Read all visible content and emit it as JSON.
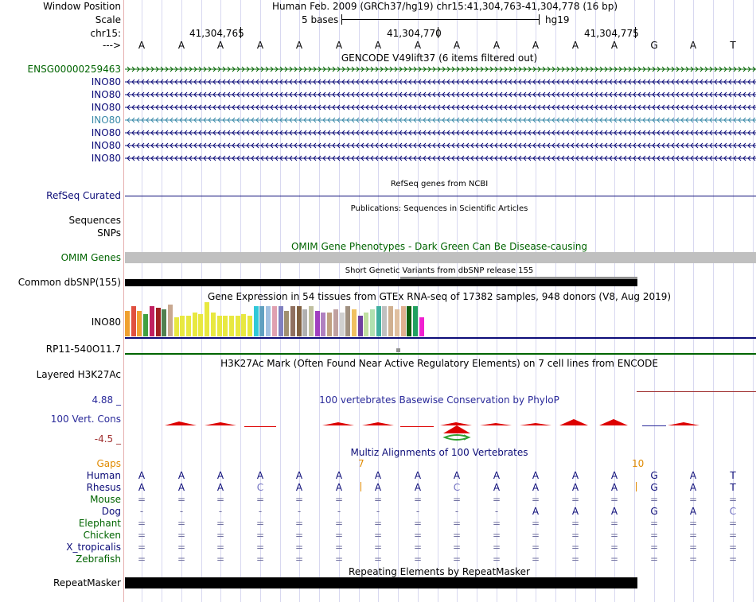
{
  "header": {
    "window_position_label": "Window Position",
    "window_position_value": "Human Feb. 2009 (GRCh37/hg19)   chr15:41,304,763-41,304,778 (16 bp)",
    "scale_label": "Scale",
    "scale_left": "5 bases",
    "scale_right": "hg19",
    "chrom_label": "chr15:",
    "arrow_label": "--->",
    "coords": [
      "41,304,765",
      "41,304,770",
      "41,304,775"
    ]
  },
  "sequence": [
    "A",
    "A",
    "A",
    "A",
    "A",
    "A",
    "A",
    "A",
    "A",
    "A",
    "A",
    "A",
    "A",
    "G",
    "A",
    "T"
  ],
  "gencode": {
    "title": "GENCODE V49lift37 (6 items filtered out)",
    "items": [
      {
        "name": "ENSG00000259463",
        "color": "#006400",
        "dir": "right"
      },
      {
        "name": "INO80",
        "color": "#0c0c78",
        "dir": "left"
      },
      {
        "name": "INO80",
        "color": "#0c0c78",
        "dir": "left"
      },
      {
        "name": "INO80",
        "color": "#0c0c78",
        "dir": "left"
      },
      {
        "name": "INO80",
        "color": "#3a8aa8",
        "dir": "left"
      },
      {
        "name": "INO80",
        "color": "#0c0c78",
        "dir": "left"
      },
      {
        "name": "INO80",
        "color": "#0c0c78",
        "dir": "left"
      },
      {
        "name": "INO80",
        "color": "#0c0c78",
        "dir": "left"
      }
    ]
  },
  "refseq": {
    "label": "RefSeq Curated",
    "title": "RefSeq genes from NCBI"
  },
  "publications": {
    "title": "Publications: Sequences in Scientific Articles",
    "label1": "Sequences",
    "label2": "SNPs"
  },
  "omim": {
    "title": "OMIM Gene Phenotypes - Dark Green Can Be Disease-causing",
    "label": "OMIM Genes"
  },
  "dbsnp": {
    "title": "Short Genetic Variants from dbSNP release 155",
    "label": "Common dbSNP(155)"
  },
  "gtex": {
    "title": "Gene Expression in 54 tissues from GTEx RNA-seq of 17382 samples, 948 donors (V8, Aug 2019)",
    "label": "INO80",
    "label2": "RP11-540O11.7",
    "bars": [
      {
        "v": 0.8,
        "c": "#f0a030"
      },
      {
        "v": 0.95,
        "c": "#e05040"
      },
      {
        "v": 0.8,
        "c": "#f0a030"
      },
      {
        "v": 0.7,
        "c": "#40a040"
      },
      {
        "v": 0.95,
        "c": "#c02060"
      },
      {
        "v": 0.9,
        "c": "#a02020"
      },
      {
        "v": 0.85,
        "c": "#508050"
      },
      {
        "v": 1.0,
        "c": "#c8a890"
      },
      {
        "v": 0.6,
        "c": "#e8e840"
      },
      {
        "v": 0.65,
        "c": "#e8e840"
      },
      {
        "v": 0.65,
        "c": "#e8e840"
      },
      {
        "v": 0.75,
        "c": "#e8e840"
      },
      {
        "v": 0.7,
        "c": "#e8e840"
      },
      {
        "v": 1.08,
        "c": "#e8e840"
      },
      {
        "v": 0.75,
        "c": "#e8e840"
      },
      {
        "v": 0.65,
        "c": "#e8e840"
      },
      {
        "v": 0.65,
        "c": "#e8e840"
      },
      {
        "v": 0.65,
        "c": "#e8e840"
      },
      {
        "v": 0.65,
        "c": "#e8e840"
      },
      {
        "v": 0.7,
        "c": "#e8e840"
      },
      {
        "v": 0.65,
        "c": "#e8e840"
      },
      {
        "v": 0.95,
        "c": "#30c8d8"
      },
      {
        "v": 0.95,
        "c": "#60a0c0"
      },
      {
        "v": 0.95,
        "c": "#a0c0e0"
      },
      {
        "v": 0.95,
        "c": "#e0a0b0"
      },
      {
        "v": 0.95,
        "c": "#8080c0"
      },
      {
        "v": 0.8,
        "c": "#a09070"
      },
      {
        "v": 0.95,
        "c": "#907060"
      },
      {
        "v": 0.95,
        "c": "#806040"
      },
      {
        "v": 0.85,
        "c": "#b0b0b0"
      },
      {
        "v": 0.95,
        "c": "#c0c0a0"
      },
      {
        "v": 0.8,
        "c": "#a040c0"
      },
      {
        "v": 0.75,
        "c": "#b080c0"
      },
      {
        "v": 0.75,
        "c": "#c0a080"
      },
      {
        "v": 0.85,
        "c": "#c0a0a0"
      },
      {
        "v": 0.75,
        "c": "#d0d0d0"
      },
      {
        "v": 0.95,
        "c": "#a09080"
      },
      {
        "v": 0.85,
        "c": "#f0c060"
      },
      {
        "v": 0.65,
        "c": "#7040a0"
      },
      {
        "v": 0.75,
        "c": "#c0e0a0"
      },
      {
        "v": 0.85,
        "c": "#b0e0b0"
      },
      {
        "v": 0.95,
        "c": "#40b0a0"
      },
      {
        "v": 0.95,
        "c": "#c0c0c0"
      },
      {
        "v": 0.95,
        "c": "#d0b090"
      },
      {
        "v": 0.85,
        "c": "#e0c0a0"
      },
      {
        "v": 0.95,
        "c": "#e0b090"
      },
      {
        "v": 0.95,
        "c": "#106010"
      },
      {
        "v": 0.95,
        "c": "#20a060"
      },
      {
        "v": 0.6,
        "c": "#f020d0"
      }
    ]
  },
  "h3k27ac": {
    "title": "H3K27Ac Mark (Often Found Near Active Regulatory Elements) on 7 cell lines from ENCODE",
    "label": "Layered H3K27Ac"
  },
  "phylop": {
    "title": "100 vertebrates Basewise Conservation by PhyloP",
    "label": "100 Vert. Cons",
    "max": "4.88 _",
    "min": "-4.5 _"
  },
  "multiz": {
    "title": "Multiz Alignments of 100 Vertebrates",
    "gaps_label": "Gaps",
    "gap_marks": [
      "7",
      "10"
    ],
    "species": [
      {
        "name": "Human",
        "color": "#0c0c78",
        "bases": [
          "A",
          "A",
          "A",
          "A",
          "A",
          "A",
          "A",
          "A",
          "A",
          "A",
          "A",
          "A",
          "A",
          "G",
          "A",
          "T"
        ]
      },
      {
        "name": "Rhesus",
        "color": "#0c0c78",
        "bases": [
          "A",
          "A",
          "A",
          "C",
          "A",
          "A",
          "A",
          "A",
          "C",
          "A",
          "A",
          "A",
          "A",
          "G",
          "A",
          "T"
        ]
      },
      {
        "name": "Mouse",
        "color": "#006400",
        "bases": [
          "=",
          "=",
          "=",
          "=",
          "=",
          "=",
          "=",
          "=",
          "=",
          "=",
          "=",
          "=",
          "=",
          "=",
          "=",
          "="
        ]
      },
      {
        "name": "Dog",
        "color": "#0c0c78",
        "bases": [
          "-",
          "-",
          "-",
          "-",
          "-",
          "-",
          "-",
          "-",
          "-",
          "-",
          "A",
          "A",
          "A",
          "G",
          "A",
          "C"
        ]
      },
      {
        "name": "Elephant",
        "color": "#006400",
        "bases": [
          "=",
          "=",
          "=",
          "=",
          "=",
          "=",
          "=",
          "=",
          "=",
          "=",
          "=",
          "=",
          "=",
          "=",
          "=",
          "="
        ]
      },
      {
        "name": "Chicken",
        "color": "#006400",
        "bases": [
          "=",
          "=",
          "=",
          "=",
          "=",
          "=",
          "=",
          "=",
          "=",
          "=",
          "=",
          "=",
          "=",
          "=",
          "=",
          "="
        ]
      },
      {
        "name": "X_tropicalis",
        "color": "#0c0c78",
        "bases": [
          "=",
          "=",
          "=",
          "=",
          "=",
          "=",
          "=",
          "=",
          "=",
          "=",
          "=",
          "=",
          "=",
          "=",
          "=",
          "="
        ]
      },
      {
        "name": "Zebrafish",
        "color": "#006400",
        "bases": [
          "=",
          "=",
          "=",
          "=",
          "=",
          "=",
          "=",
          "=",
          "=",
          "=",
          "=",
          "=",
          "=",
          "=",
          "=",
          "="
        ]
      }
    ]
  },
  "repeatmasker": {
    "title": "Repeating Elements by RepeatMasker",
    "label": "RepeatMasker"
  }
}
